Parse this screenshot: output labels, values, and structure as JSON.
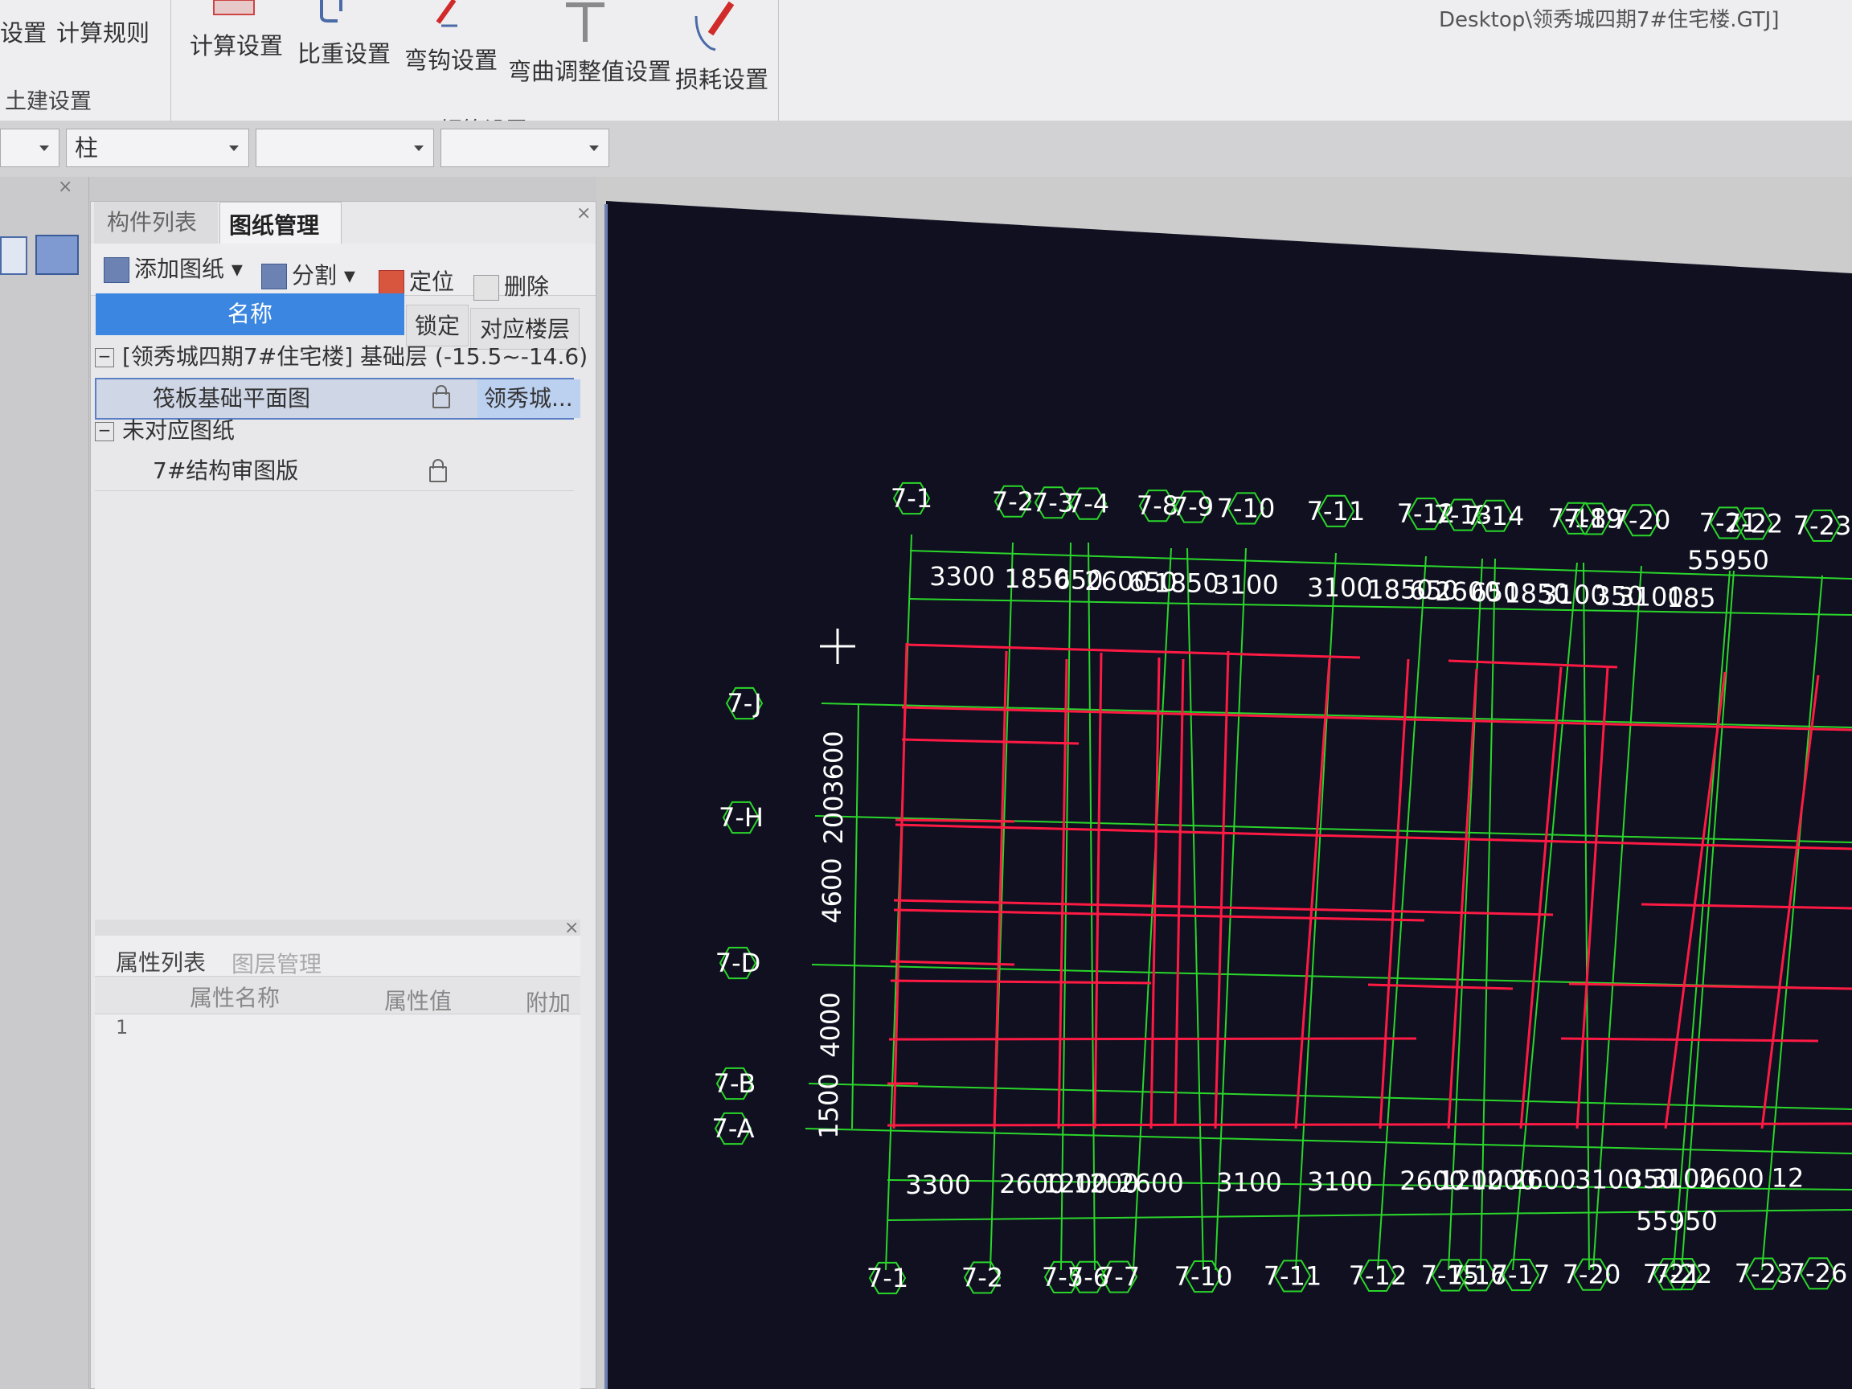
{
  "ribbon": {
    "item_shezhi": "设置",
    "item_jisuanguize": "计算规则",
    "item_jisuanshezhi": "计算设置",
    "item_bizhongshezhi": "比重设置",
    "item_wangoushezhi": "弯钩设置",
    "item_wanqutiaozheng": "弯曲调整值设置",
    "item_sunhaoshezhi": "损耗设置",
    "group_tujian": "土建设置",
    "group_gangjin": "钢筋设置",
    "title_path": "Desktop\\领秀城四期7#住宅楼.GTJ]"
  },
  "combos": {
    "c2_value": "柱"
  },
  "panel": {
    "tab_goujian": "构件列表",
    "tab_tuzhi": "图纸管理",
    "btn_add": "添加图纸",
    "btn_split": "分割",
    "btn_locate": "定位",
    "btn_delete": "删除",
    "col_name": "名称",
    "col_lock": "锁定",
    "col_floor": "对应楼层",
    "row1": "[领秀城四期7#住宅楼] 基础层 (-15.5~-14.6)",
    "row2_name": "筏板基础平面图",
    "row2_floor": "领秀城...",
    "row3": "未对应图纸",
    "row4_name": "7#结构审图版"
  },
  "props": {
    "tab_attr": "属性列表",
    "tab_layer": "图层管理",
    "col_attr_name": "属性名称",
    "col_attr_value": "属性值",
    "col_extra": "附加",
    "row_num": "1"
  },
  "cad": {
    "colors": {
      "background": "#0f0f1d",
      "axis": "#2ad62a",
      "beam": "#ff1a44",
      "text": "#ffffff"
    },
    "top_axes": [
      "7-1",
      "7-2",
      "7-3",
      "7-4",
      "7-8",
      "7-9",
      "7-10",
      "7-11",
      "7-12",
      "7-13",
      "7-14",
      "7-18",
      "7-19",
      "7-20",
      "7-21",
      "7-22",
      "7-23"
    ],
    "top_dims": [
      "3300",
      "1850",
      "650",
      "2600",
      "650",
      "1850",
      "3100",
      "3100",
      "1850",
      "650",
      "2600",
      "650",
      "1850",
      "3100",
      "350",
      "3100",
      "185"
    ],
    "top_total": "55950",
    "bottom_axes": [
      "7-1",
      "7-2",
      "7-5",
      "7-6",
      "7-7",
      "7-10",
      "7-11",
      "7-12",
      "7-15",
      "7-16",
      "7-17",
      "7-20",
      "7-21",
      "7-22",
      "7-23",
      "7-26"
    ],
    "bottom_dims": [
      "3300",
      "2600",
      "1200",
      "1200",
      "2600",
      "3100",
      "3100",
      "2600",
      "1200",
      "1200",
      "2600",
      "3100",
      "350",
      "3100",
      "2600",
      "12"
    ],
    "bottom_total": "55950",
    "left_axes": [
      "7-J",
      "7-H",
      "7-D",
      "7-B",
      "7-A"
    ],
    "left_dims": [
      "3600",
      "200",
      "4600",
      "4000",
      "1500"
    ]
  }
}
